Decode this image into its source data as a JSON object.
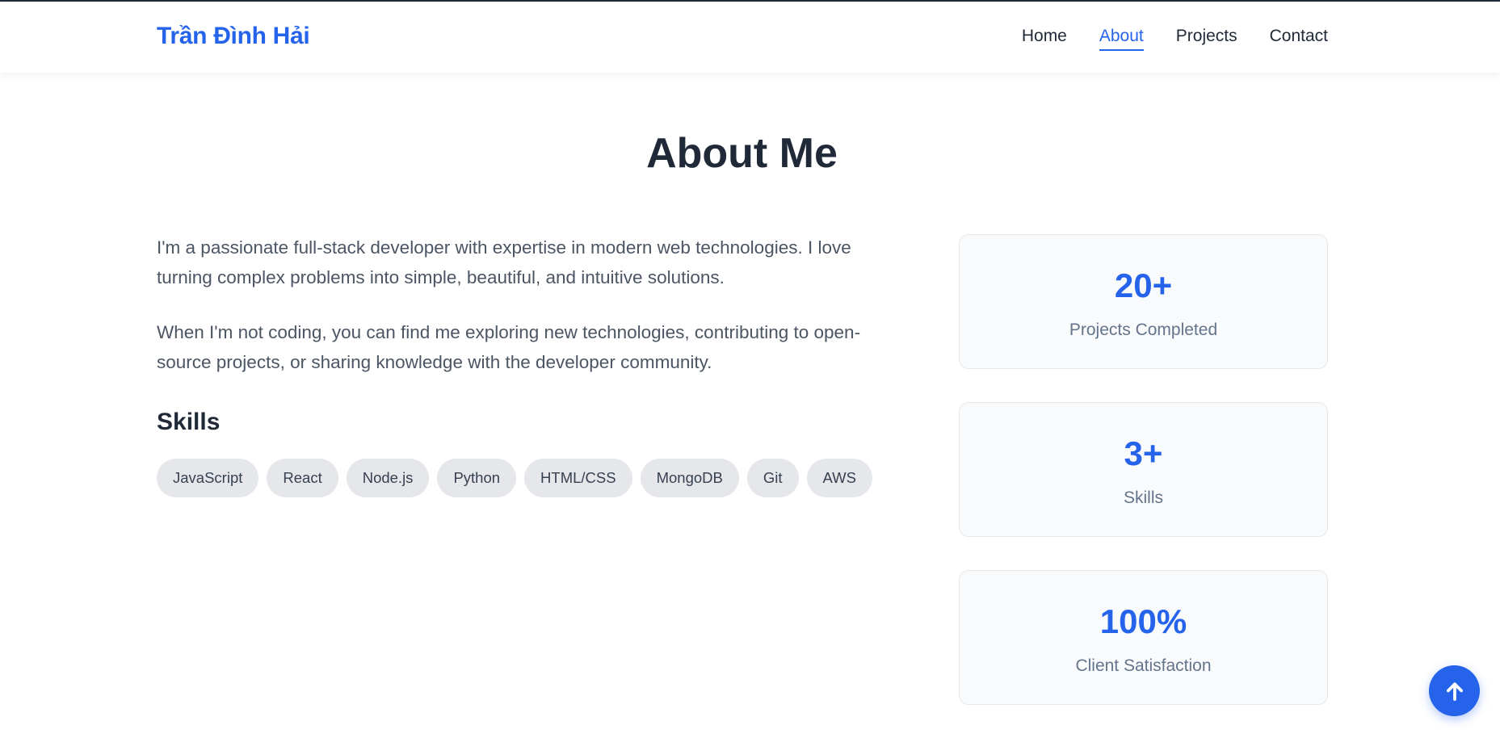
{
  "header": {
    "brand": "Trần Đình Hải",
    "nav": [
      {
        "label": "Home"
      },
      {
        "label": "About"
      },
      {
        "label": "Projects"
      },
      {
        "label": "Contact"
      }
    ],
    "active": "About"
  },
  "about": {
    "title": "About Me",
    "paragraphs": [
      "I'm a passionate full-stack developer with expertise in modern web technologies. I love turning complex problems into simple, beautiful, and intuitive solutions.",
      "When I'm not coding, you can find me exploring new technologies, contributing to open-source projects, or sharing knowledge with the developer community."
    ],
    "skills_heading": "Skills",
    "skills": [
      "JavaScript",
      "React",
      "Node.js",
      "Python",
      "HTML/CSS",
      "MongoDB",
      "Git",
      "AWS"
    ]
  },
  "stats": [
    {
      "value": "20+",
      "label": "Projects Completed"
    },
    {
      "value": "3+",
      "label": "Skills"
    },
    {
      "value": "100%",
      "label": "Client Satisfaction"
    }
  ],
  "scroll_top": {
    "icon": "arrow-up-icon"
  },
  "colors": {
    "accent": "#2563eb",
    "text": "#1f2937",
    "muted": "#4b5563",
    "chip_bg": "#e5e7eb",
    "card_bg": "#f8fafc"
  }
}
